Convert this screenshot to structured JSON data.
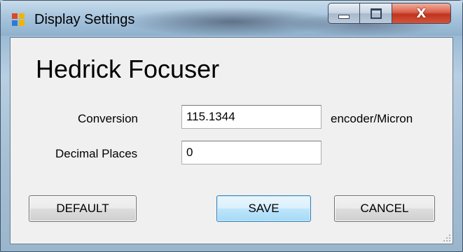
{
  "window": {
    "title": "Display Settings",
    "app_icon": "app-window-icon",
    "caption_buttons": {
      "minimize_icon": "minimize-icon",
      "maximize_icon": "maximize-icon",
      "close_icon": "close-icon",
      "close_glyph": "X"
    }
  },
  "form": {
    "heading": "Hedrick Focuser",
    "conversion": {
      "label": "Conversion",
      "value": "115.1344",
      "unit": "encoder/Micron"
    },
    "decimal_places": {
      "label": "Decimal Places",
      "value": "0"
    }
  },
  "buttons": {
    "default_label": "DEFAULT",
    "save_label": "SAVE",
    "cancel_label": "CANCEL"
  },
  "colors": {
    "accent_focus": "#3c7fb1",
    "close_button": "#c0341f",
    "client_background": "#f0f0f0"
  }
}
